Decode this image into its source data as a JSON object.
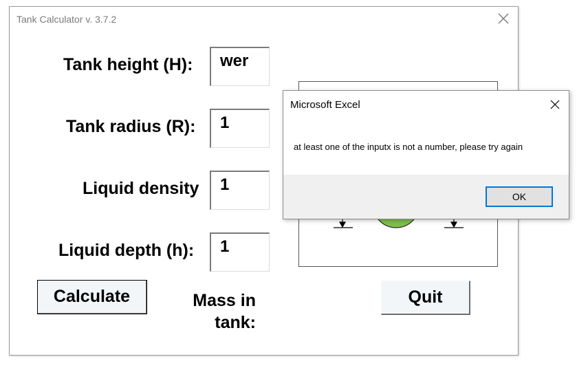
{
  "form": {
    "title": "Tank Calculator v. 3.7.2",
    "fields": {
      "tank_height": {
        "label": "Tank height (H):",
        "value": "wer"
      },
      "tank_radius": {
        "label": "Tank radius (R):",
        "value": "1"
      },
      "liquid_density": {
        "label": "Liquid density",
        "value": "1"
      },
      "liquid_depth": {
        "label": "Liquid depth (h):",
        "value": "1"
      }
    },
    "calculate_label": "Calculate",
    "quit_label": "Quit",
    "mass_label_line1": "Mass in",
    "mass_label_line2": "tank:",
    "diagram_fill_color": "#7fbf4d"
  },
  "msgbox": {
    "title": "Microsoft Excel",
    "message": "at least one of the inputx is not a number, please try again",
    "ok_label": "OK",
    "accent": "#0078d7"
  }
}
